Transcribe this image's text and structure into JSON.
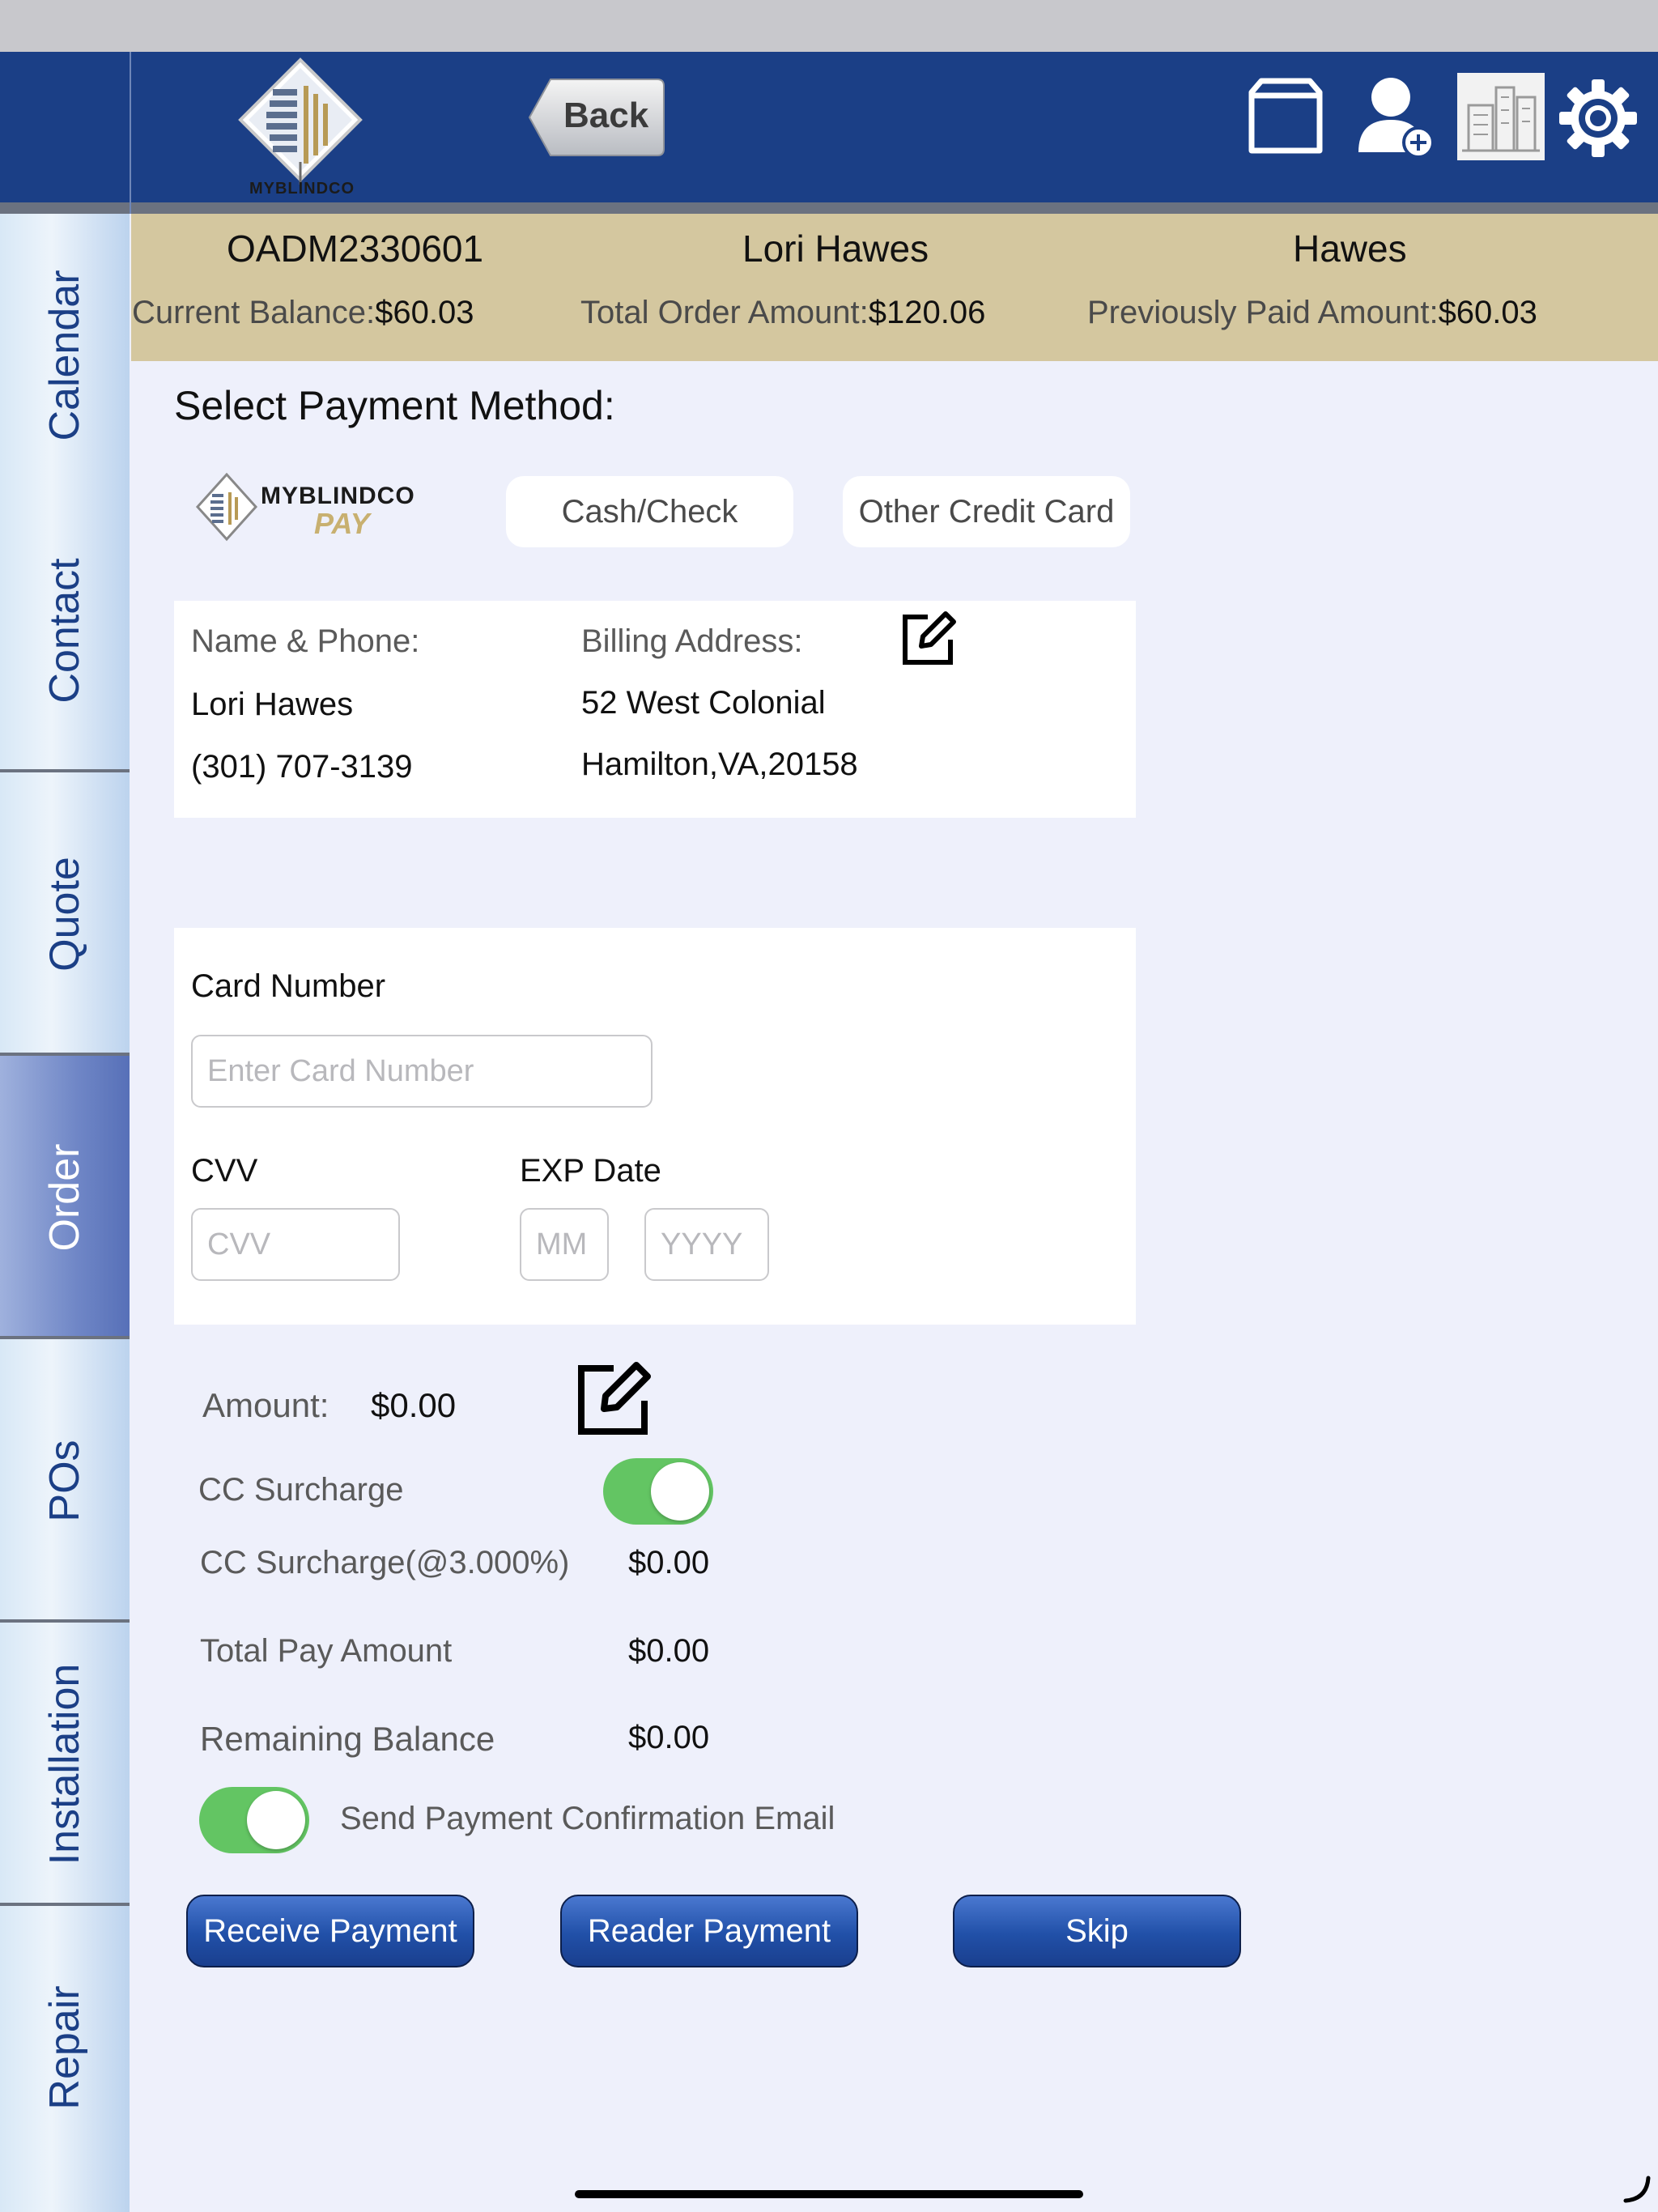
{
  "header": {
    "logo_text": "MYBLINDCO",
    "back_label": "Back",
    "icons": [
      "box-icon",
      "add-user-icon",
      "building-icon",
      "settings-icon"
    ]
  },
  "sidebar": {
    "tabs": [
      {
        "label": "Calendar"
      },
      {
        "label": "Contact"
      },
      {
        "label": "Quote"
      },
      {
        "label": "Order"
      },
      {
        "label": "POs"
      },
      {
        "label": "Installation"
      },
      {
        "label": "Repair"
      }
    ],
    "active": "Order"
  },
  "order": {
    "number": "OADM2330601",
    "customer_name": "Lori Hawes",
    "last_name": "Hawes",
    "current_balance_label": "Current Balance:",
    "current_balance": "$60.03",
    "total_order_label": "Total Order Amount:",
    "total_order": "$120.06",
    "prev_paid_label": "Previously Paid Amount:",
    "prev_paid": "$60.03"
  },
  "payment": {
    "title": "Select Payment Method:",
    "methods": {
      "brand_line1": "MYBLINDCO",
      "brand_line2": "PAY",
      "cash": "Cash/Check",
      "other_cc": "Other Credit Card"
    },
    "contact": {
      "name_phone_label": "Name & Phone:",
      "name": "Lori Hawes",
      "phone": "(301) 707-3139",
      "billing_label": "Billing Address:",
      "address1": "52 West Colonial",
      "address2": "Hamilton,VA,20158"
    },
    "card": {
      "number_label": "Card Number",
      "number_placeholder": "Enter Card Number",
      "cvv_label": "CVV",
      "cvv_placeholder": "CVV",
      "exp_label": "EXP Date",
      "mm_placeholder": "MM",
      "yyyy_placeholder": "YYYY"
    },
    "amount_label": "Amount:",
    "amount": "$0.00",
    "surcharge_toggle_label": "CC Surcharge",
    "surcharge_enabled": true,
    "surcharge_label": "CC Surcharge(@3.000%)",
    "surcharge": "$0.00",
    "total_label": "Total Pay Amount",
    "total": "$0.00",
    "remaining_label": "Remaining Balance",
    "remaining": "$0.00",
    "email_toggle_label": "Send Payment Confirmation Email",
    "email_enabled": true
  },
  "actions": {
    "receive": "Receive Payment",
    "reader": "Reader Payment",
    "skip": "Skip"
  },
  "colors": {
    "header_bg": "#1b3f86",
    "banner_bg": "#d4c79f",
    "content_bg": "#eef0fb",
    "toggle_on": "#63c563",
    "button_blue": "#2150a8"
  }
}
